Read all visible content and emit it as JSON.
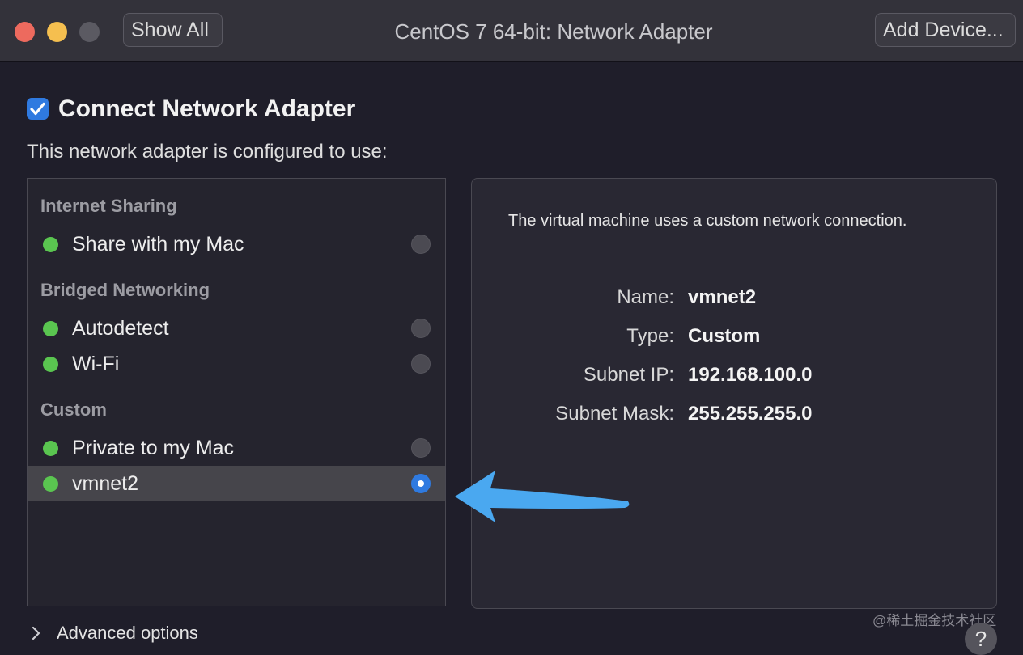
{
  "window": {
    "title": "CentOS 7 64-bit: Network Adapter",
    "show_all_label": "Show All",
    "add_device_label": "Add Device..."
  },
  "connect": {
    "label": "Connect Network Adapter",
    "checked": true
  },
  "configured_text": "This network adapter is configured to use:",
  "groups": [
    {
      "header": "Internet Sharing",
      "items": [
        {
          "label": "Share with my Mac",
          "selected": false
        }
      ]
    },
    {
      "header": "Bridged Networking",
      "items": [
        {
          "label": "Autodetect",
          "selected": false
        },
        {
          "label": "Wi-Fi",
          "selected": false
        }
      ]
    },
    {
      "header": "Custom",
      "items": [
        {
          "label": "Private to my Mac",
          "selected": false
        },
        {
          "label": "vmnet2",
          "selected": true
        }
      ]
    }
  ],
  "details": {
    "description": "The virtual machine uses a custom network connection.",
    "fields": [
      {
        "key": "Name:",
        "value": "vmnet2"
      },
      {
        "key": "Type:",
        "value": "Custom"
      },
      {
        "key": "Subnet IP:",
        "value": "192.168.100.0"
      },
      {
        "key": "Subnet Mask:",
        "value": "255.255.255.0"
      }
    ]
  },
  "advanced_label": "Advanced options",
  "help_label": "?",
  "watermark": "@稀土掘金技术社区",
  "colors": {
    "accent": "#2f7ae0",
    "status_green": "#5ac550",
    "annotation_arrow": "#4aa8f0"
  },
  "icons": {
    "checkbox": "checkmark-icon",
    "status": "status-dot-icon",
    "advanced": "chevron-right-icon",
    "annotation": "arrow-left-icon"
  }
}
